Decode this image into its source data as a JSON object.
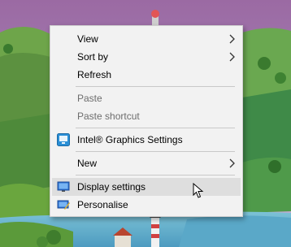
{
  "context_menu": {
    "items": [
      {
        "label": "View",
        "submenu": true
      },
      {
        "label": "Sort by",
        "submenu": true
      },
      {
        "label": "Refresh"
      },
      {
        "label": "Paste",
        "disabled": true
      },
      {
        "label": "Paste shortcut",
        "disabled": true
      },
      {
        "label": "Intel® Graphics Settings",
        "icon": "intel-graphics-icon"
      },
      {
        "label": "New",
        "submenu": true
      },
      {
        "label": "Display settings",
        "icon": "display-settings-icon",
        "highlighted": true
      },
      {
        "label": "Personalise",
        "icon": "personalise-icon"
      }
    ]
  },
  "colors": {
    "menu_background": "#f2f2f2",
    "hover_background": "#dedede",
    "disabled_text": "#6d6d6d",
    "sky_top": "#9b6aa3"
  }
}
